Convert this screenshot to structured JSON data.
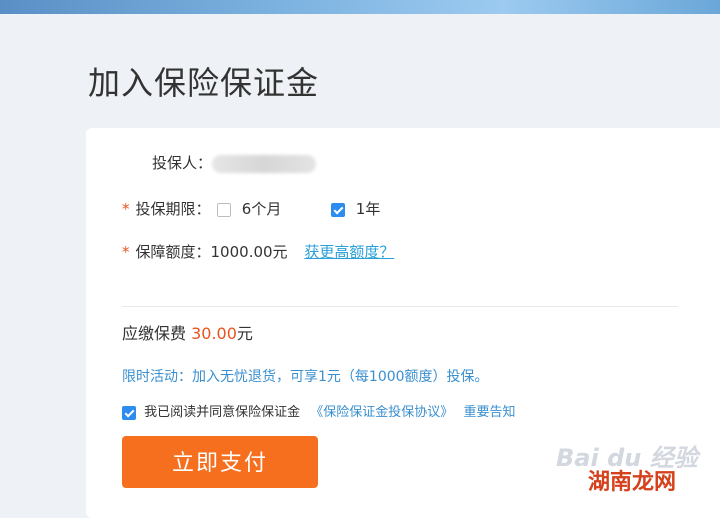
{
  "page": {
    "title": "加入保险保证金"
  },
  "form": {
    "insured_label": "投保人：",
    "period": {
      "required_mark": "*",
      "label": "投保期限：",
      "options": [
        {
          "label": "6个月",
          "checked": false
        },
        {
          "label": "1年",
          "checked": true
        }
      ]
    },
    "coverage": {
      "required_mark": "*",
      "label": "保障额度：",
      "value": "1000.00元",
      "link": "获更高额度？"
    }
  },
  "premium": {
    "label": "应缴保费 ",
    "amount": "30.00",
    "unit": "元"
  },
  "promo": {
    "text": "限时活动：加入无忧退货，可享1元（每1000额度）投保。"
  },
  "agreement": {
    "checked": true,
    "text": "我已阅读并同意保险保证金",
    "doc_link": "《保险保证金投保协议》",
    "notice_link": "重要告知"
  },
  "pay_button": {
    "label": "立即支付"
  },
  "watermarks": {
    "baidu": "Bai du 经验",
    "site": "湖南龙网"
  },
  "colors": {
    "accent": "#e8541e",
    "button": "#f56f1f",
    "link": "#2aa0d8",
    "checkbox": "#2d8cf0"
  }
}
